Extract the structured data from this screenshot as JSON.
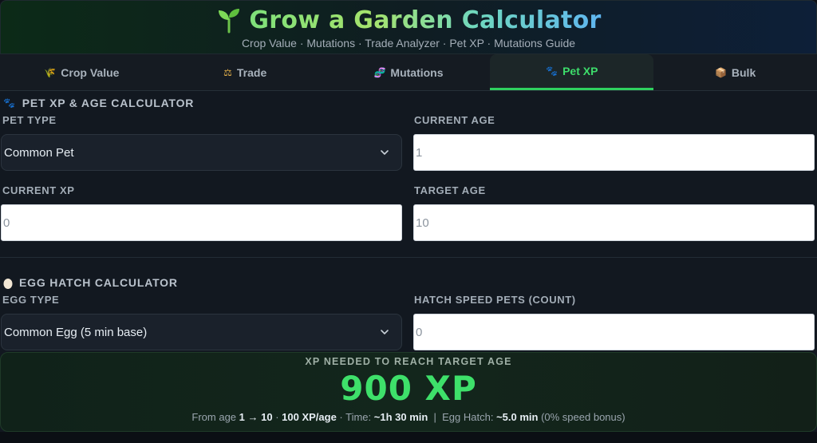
{
  "header": {
    "title": "Grow a Garden Calculator",
    "subtitle": "Crop Value · Mutations · Trade Analyzer · Pet XP · Mutations Guide"
  },
  "tabs": [
    {
      "label": "Crop Value",
      "icon": "wheat-icon",
      "active": false
    },
    {
      "label": "Trade",
      "icon": "scales-icon",
      "active": false
    },
    {
      "label": "Mutations",
      "icon": "dna-icon",
      "active": false
    },
    {
      "label": "Pet XP",
      "icon": "paw-icon",
      "active": true
    },
    {
      "label": "Bulk",
      "icon": "box-icon",
      "active": false
    }
  ],
  "pet_section": {
    "title": "PET XP & AGE CALCULATOR",
    "pet_type_label": "PET TYPE",
    "pet_type_value": "Common Pet",
    "current_age_label": "CURRENT AGE",
    "current_age_value": "1",
    "current_xp_label": "CURRENT XP",
    "current_xp_value": "0",
    "target_age_label": "TARGET AGE",
    "target_age_value": "10"
  },
  "egg_section": {
    "title": "EGG HATCH CALCULATOR",
    "egg_type_label": "EGG TYPE",
    "egg_type_value": "Common Egg (5 min base)",
    "hatch_speed_label": "HATCH SPEED PETS (COUNT)",
    "hatch_speed_value": "0"
  },
  "result": {
    "label": "XP NEEDED TO REACH TARGET AGE",
    "value": "900 XP",
    "from_prefix": "From age ",
    "age_range": "1 → 10",
    "sep1": " · ",
    "rate": "100 XP/age",
    "time_prefix": " · Time: ",
    "time": "~1h 30 min",
    "pipe": "  |  ",
    "egg_prefix": "Egg Hatch: ",
    "egg_time": "~5.0 min",
    "bonus": " (0% speed bonus)"
  },
  "colors": {
    "accent": "#3ee06a",
    "background": "#121820"
  }
}
